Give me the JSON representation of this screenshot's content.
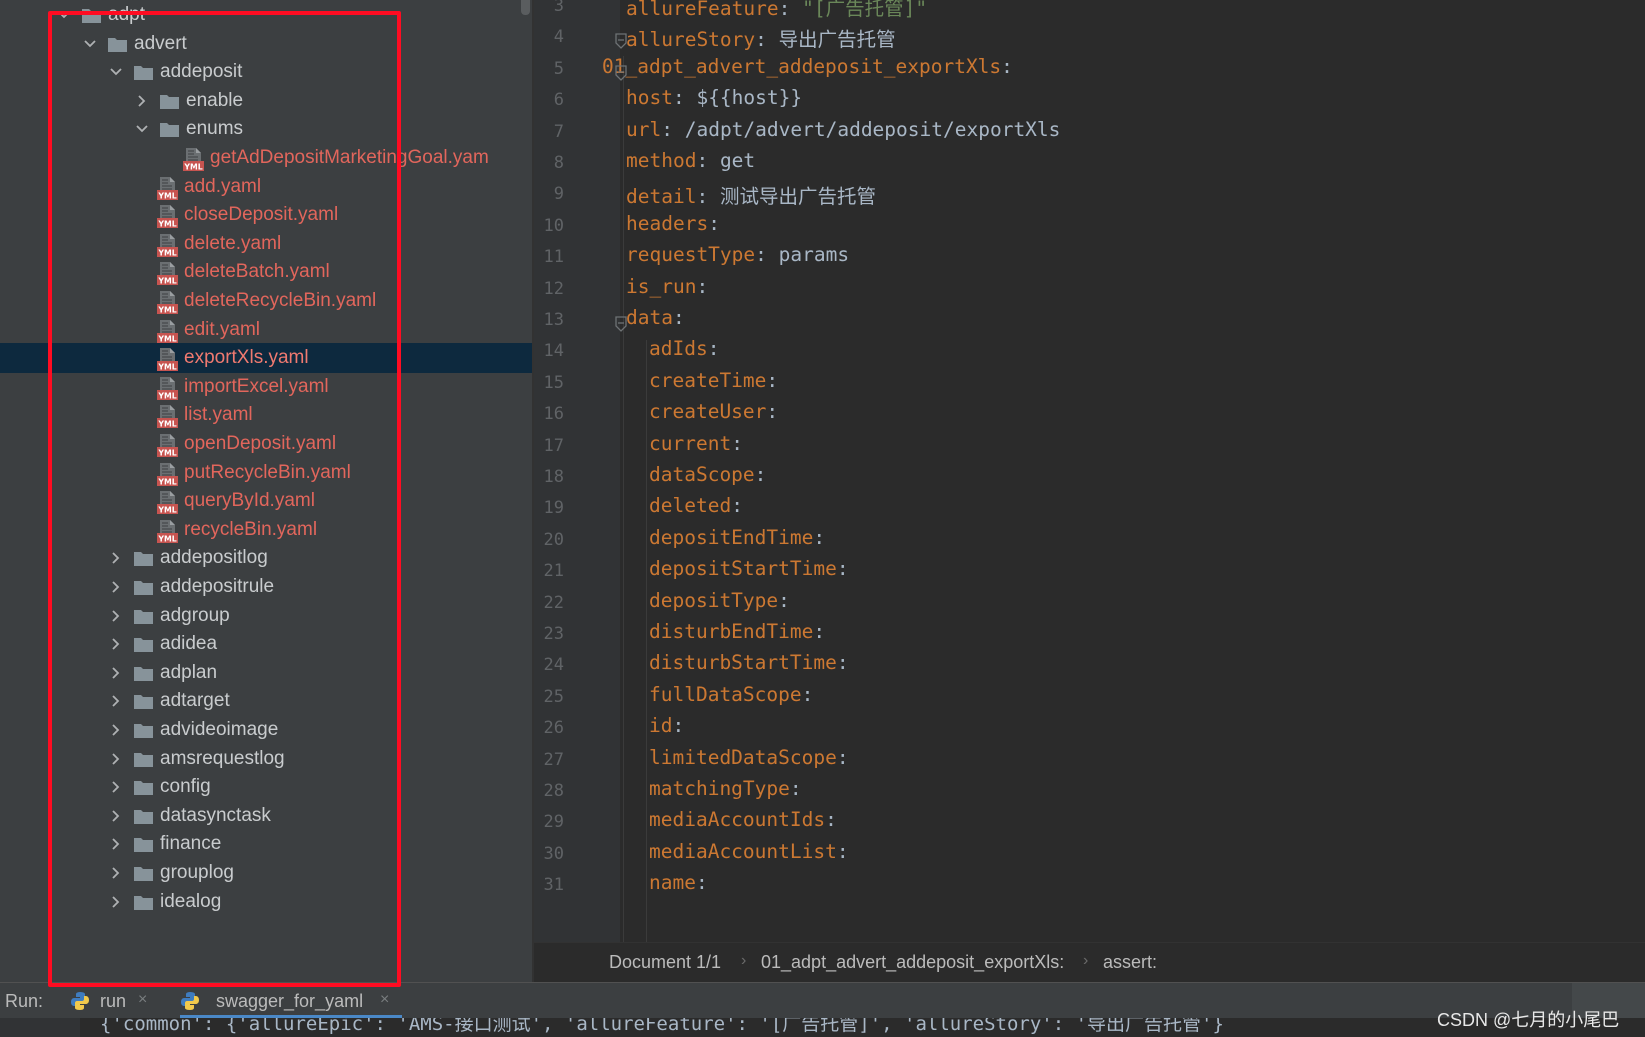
{
  "tree": {
    "items": [
      {
        "label": "adpt",
        "kind": "folder",
        "state": "open"
      },
      {
        "label": "advert",
        "kind": "folder",
        "state": "open"
      },
      {
        "label": "addeposit",
        "kind": "folder",
        "state": "open"
      },
      {
        "label": "enable",
        "kind": "folder",
        "state": "closed"
      },
      {
        "label": "enums",
        "kind": "folder",
        "state": "open"
      },
      {
        "label": "getAdDepositMarketingGoal.yam",
        "kind": "file"
      },
      {
        "label": "add.yaml",
        "kind": "file"
      },
      {
        "label": "closeDeposit.yaml",
        "kind": "file"
      },
      {
        "label": "delete.yaml",
        "kind": "file"
      },
      {
        "label": "deleteBatch.yaml",
        "kind": "file"
      },
      {
        "label": "deleteRecycleBin.yaml",
        "kind": "file"
      },
      {
        "label": "edit.yaml",
        "kind": "file"
      },
      {
        "label": "exportXls.yaml",
        "kind": "file",
        "selected": true
      },
      {
        "label": "importExcel.yaml",
        "kind": "file"
      },
      {
        "label": "list.yaml",
        "kind": "file"
      },
      {
        "label": "openDeposit.yaml",
        "kind": "file"
      },
      {
        "label": "putRecycleBin.yaml",
        "kind": "file"
      },
      {
        "label": "queryById.yaml",
        "kind": "file"
      },
      {
        "label": "recycleBin.yaml",
        "kind": "file"
      },
      {
        "label": "addepositlog",
        "kind": "folder",
        "state": "closed"
      },
      {
        "label": "addepositrule",
        "kind": "folder",
        "state": "closed"
      },
      {
        "label": "adgroup",
        "kind": "folder",
        "state": "closed"
      },
      {
        "label": "adidea",
        "kind": "folder",
        "state": "closed"
      },
      {
        "label": "adplan",
        "kind": "folder",
        "state": "closed"
      },
      {
        "label": "adtarget",
        "kind": "folder",
        "state": "closed"
      },
      {
        "label": "advideoimage",
        "kind": "folder",
        "state": "closed"
      },
      {
        "label": "amsrequestlog",
        "kind": "folder",
        "state": "closed"
      },
      {
        "label": "config",
        "kind": "folder",
        "state": "closed"
      },
      {
        "label": "datasynctask",
        "kind": "folder",
        "state": "closed"
      },
      {
        "label": "finance",
        "kind": "folder",
        "state": "closed"
      },
      {
        "label": "grouplog",
        "kind": "folder",
        "state": "closed"
      },
      {
        "label": "idealog",
        "kind": "folder",
        "state": "closed"
      }
    ],
    "file_badge": "YML"
  },
  "editor": {
    "lines": [
      {
        "n": "3",
        "key": "allureFeature",
        "sep": ": ",
        "value": "\"[广告托管]\"",
        "type": "str"
      },
      {
        "n": "4",
        "key": "allureStory",
        "sep": ": ",
        "value": "导出广告托管",
        "type": "val"
      },
      {
        "n": "5",
        "key": "01_adpt_advert_addeposit_exportXls",
        "sep": ":",
        "value": "",
        "type": "val"
      },
      {
        "n": "6",
        "key": "host",
        "sep": ": ",
        "value": "${{host}}",
        "type": "val"
      },
      {
        "n": "7",
        "key": "url",
        "sep": ": ",
        "value": "/adpt/advert/addeposit/exportXls",
        "type": "val"
      },
      {
        "n": "8",
        "key": "method",
        "sep": ": ",
        "value": "get",
        "type": "val"
      },
      {
        "n": "9",
        "key": "detail",
        "sep": ": ",
        "value": "测试导出广告托管",
        "type": "val"
      },
      {
        "n": "10",
        "key": "headers",
        "sep": ":",
        "value": "",
        "type": "val"
      },
      {
        "n": "11",
        "key": "requestType",
        "sep": ": ",
        "value": "params",
        "type": "val"
      },
      {
        "n": "12",
        "key": "is_run",
        "sep": ":",
        "value": "",
        "type": "val"
      },
      {
        "n": "13",
        "key": "data",
        "sep": ":",
        "value": "",
        "type": "val"
      },
      {
        "n": "14",
        "key": "adIds",
        "sep": ":",
        "value": "",
        "type": "val"
      },
      {
        "n": "15",
        "key": "createTime",
        "sep": ":",
        "value": "",
        "type": "val"
      },
      {
        "n": "16",
        "key": "createUser",
        "sep": ":",
        "value": "",
        "type": "val"
      },
      {
        "n": "17",
        "key": "current",
        "sep": ":",
        "value": "",
        "type": "val"
      },
      {
        "n": "18",
        "key": "dataScope",
        "sep": ":",
        "value": "",
        "type": "val"
      },
      {
        "n": "19",
        "key": "deleted",
        "sep": ":",
        "value": "",
        "type": "val"
      },
      {
        "n": "20",
        "key": "depositEndTime",
        "sep": ":",
        "value": "",
        "type": "val"
      },
      {
        "n": "21",
        "key": "depositStartTime",
        "sep": ":",
        "value": "",
        "type": "val"
      },
      {
        "n": "22",
        "key": "depositType",
        "sep": ":",
        "value": "",
        "type": "val"
      },
      {
        "n": "23",
        "key": "disturbEndTime",
        "sep": ":",
        "value": "",
        "type": "val"
      },
      {
        "n": "24",
        "key": "disturbStartTime",
        "sep": ":",
        "value": "",
        "type": "val"
      },
      {
        "n": "25",
        "key": "fullDataScope",
        "sep": ":",
        "value": "",
        "type": "val"
      },
      {
        "n": "26",
        "key": "id",
        "sep": ":",
        "value": "",
        "type": "val"
      },
      {
        "n": "27",
        "key": "limitedDataScope",
        "sep": ":",
        "value": "",
        "type": "val"
      },
      {
        "n": "28",
        "key": "matchingType",
        "sep": ":",
        "value": "",
        "type": "val"
      },
      {
        "n": "29",
        "key": "mediaAccountIds",
        "sep": ":",
        "value": "",
        "type": "val"
      },
      {
        "n": "30",
        "key": "mediaAccountList",
        "sep": ":",
        "value": "",
        "type": "val"
      },
      {
        "n": "31",
        "key": "name",
        "sep": ":",
        "value": "",
        "type": "val"
      }
    ]
  },
  "breadcrumb": {
    "items": [
      "Document 1/1",
      "01_adpt_advert_addeposit_exportXls:",
      "assert:"
    ],
    "separator": "›"
  },
  "runbar": {
    "label": "Run:",
    "tabs": [
      {
        "label": "run",
        "close": "×"
      },
      {
        "label": "swagger_for_yaml",
        "close": "×"
      }
    ]
  },
  "console": {
    "text": "{'common': {'allureEpic': 'AMS-接口测试', 'allureFeature': '[广告托管]', 'allureStory': '导出广告托管'}"
  },
  "watermark": "CSDN @七月的小尾巴",
  "colors": {
    "tree_bg": "#3c3f41",
    "editor_bg": "#2b2b2b",
    "key": "#cc7832",
    "file": "#e2665c",
    "selection": "#0d293e",
    "highlight_box": "#ff0c22"
  }
}
